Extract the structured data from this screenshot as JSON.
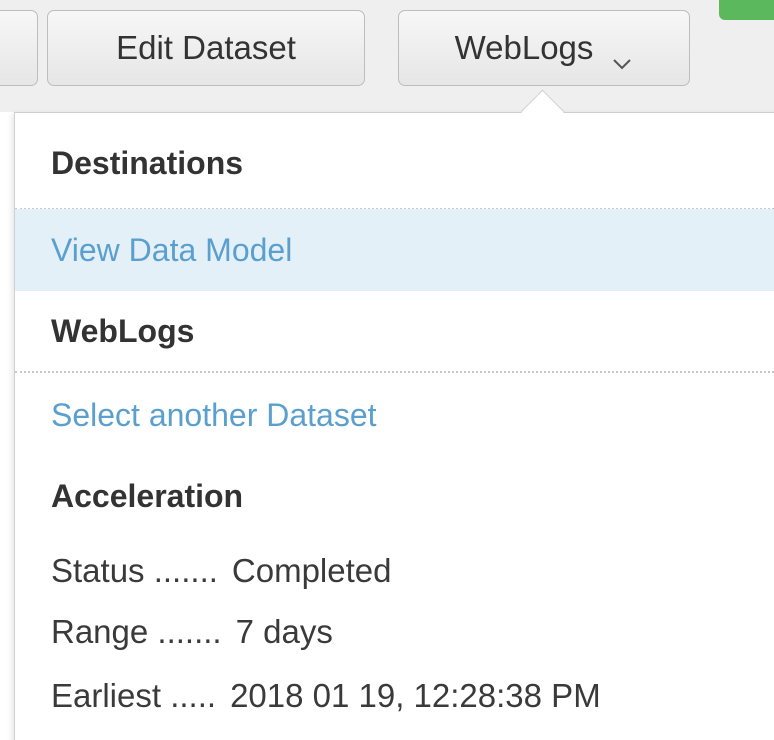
{
  "toolbar": {
    "edit_dataset_label": "Edit Dataset",
    "dataset_dropdown_label": "WebLogs"
  },
  "dropdown": {
    "destinations_header": "Destinations",
    "view_data_model": "View Data Model",
    "dataset_header": "WebLogs",
    "select_another_dataset": "Select another Dataset",
    "acceleration_header": "Acceleration",
    "acceleration": [
      {
        "label": "Status .......",
        "value": "Completed"
      },
      {
        "label": "Range .......",
        "value": "7 days"
      },
      {
        "label": "Earliest .....",
        "value": "2018 01 19, 12:28:38 PM"
      }
    ]
  },
  "colors": {
    "link": "#5a9fcd",
    "active_item_background": "#e4f0f8",
    "accent_green": "#5cb85c",
    "toolbar_background": "#efefef"
  },
  "icons": {
    "dropdown_indicator": "chevron-down-icon"
  }
}
